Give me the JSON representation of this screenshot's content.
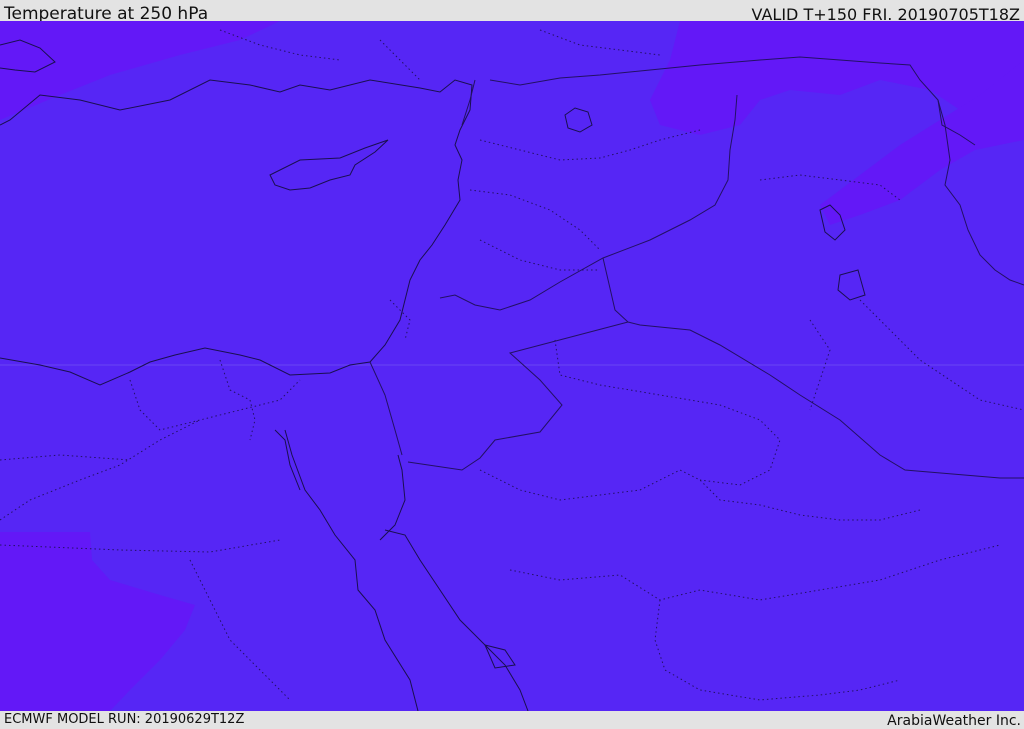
{
  "header": {
    "title": "Temperature at 250 hPa",
    "valid": "VALID T+150 FRI. 20190705T18Z"
  },
  "footer": {
    "model_run": "ECMWF MODEL RUN: 20190629T12Z",
    "credit": "ArabiaWeather Inc."
  },
  "map": {
    "colors": {
      "base_fill": "#5626f5",
      "warmer_fill": "#6318f7",
      "coastline": "#1a0f50",
      "border": "#231064"
    }
  }
}
